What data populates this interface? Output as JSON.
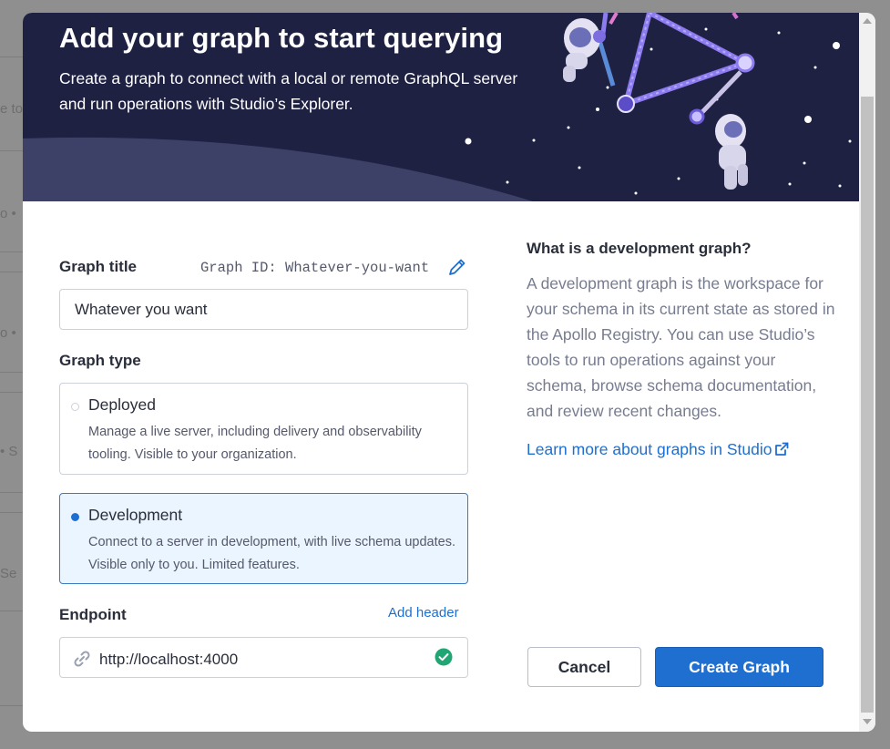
{
  "background": {
    "fragments": [
      "e to",
      "o •",
      "o •",
      "• S",
      "Se"
    ]
  },
  "dialog": {
    "hero": {
      "title": "Add your graph to start querying",
      "subtitle": "Create a graph to connect with a local or remote GraphQL server and run operations with Studio’s Explorer."
    },
    "graph_title": {
      "label": "Graph title",
      "graph_id": "Graph ID: Whatever-you-want",
      "value": "Whatever you want"
    },
    "graph_type": {
      "label": "Graph type",
      "options": [
        {
          "title": "Deployed",
          "description": "Manage a live server, including delivery and observability tooling. Visible to your organization.",
          "selected": false
        },
        {
          "title": "Development",
          "description": "Connect to a server in development, with live schema updates. Visible only to you. Limited features.",
          "selected": true
        }
      ]
    },
    "endpoint": {
      "label": "Endpoint",
      "add_header": "Add header",
      "value": "http://localhost:4000"
    },
    "sidebar": {
      "title": "What is a development graph?",
      "body": "A development graph is the workspace for your schema in its current state as stored in the Apollo Registry. You can use Studio’s tools to run operations against your schema, browse schema documentation, and review recent changes.",
      "link": "Learn more about graphs in Studio"
    },
    "buttons": {
      "cancel": "Cancel",
      "create": "Create Graph"
    }
  },
  "colors": {
    "hero_bg": "#1e2142",
    "primary": "#1f6fd1",
    "success": "#1fa672",
    "selected_bg": "#ebf5ff"
  },
  "icons": [
    "pencil-icon",
    "link-icon",
    "check-circle-icon",
    "external-link-icon",
    "radio-icon"
  ]
}
